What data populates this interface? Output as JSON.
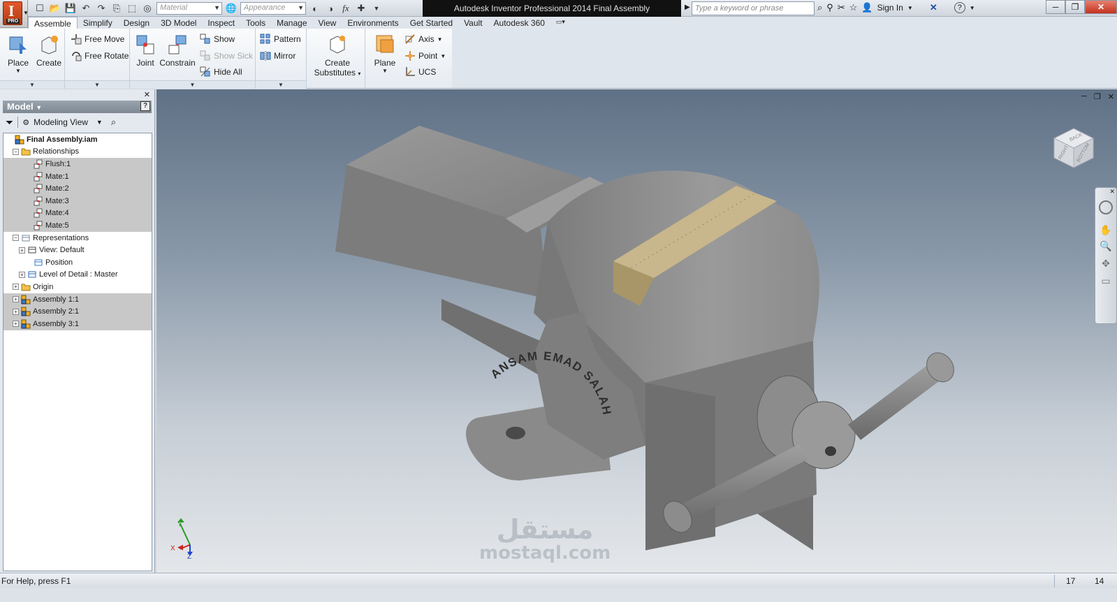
{
  "window": {
    "title": "Autodesk Inventor Professional 2014    Final Assembly",
    "app_badge": "PRO",
    "search_placeholder": "Type a keyword or phrase",
    "sign_in": "Sign In"
  },
  "qat": {
    "material_placeholder": "Material",
    "appearance_placeholder": "Appearance",
    "fx_label": "fx"
  },
  "tabs": [
    "Assemble",
    "Simplify",
    "Design",
    "3D Model",
    "Inspect",
    "Tools",
    "Manage",
    "View",
    "Environments",
    "Get Started",
    "Vault",
    "Autodesk 360"
  ],
  "ribbon": {
    "place": "Place",
    "create": "Create",
    "free_move": "Free Move",
    "free_rotate": "Free Rotate",
    "joint": "Joint",
    "constrain": "Constrain",
    "show": "Show",
    "show_sick": "Show Sick",
    "hide_all": "Hide All",
    "pattern": "Pattern",
    "mirror": "Mirror",
    "create_substitutes_1": "Create",
    "create_substitutes_2": "Substitutes",
    "plane": "Plane",
    "axis": "Axis",
    "point": "Point",
    "ucs": "UCS"
  },
  "browser": {
    "title": "Model",
    "view_label": "Modeling View",
    "tree": [
      {
        "label": "Final Assembly.iam",
        "indent": 0,
        "exp": "",
        "sel": false,
        "bold": true,
        "icon": "assembly-icon"
      },
      {
        "label": "Relationships",
        "indent": 1,
        "exp": "−",
        "sel": false,
        "bold": false,
        "icon": "folder-open-icon"
      },
      {
        "label": "Flush:1",
        "indent": 3,
        "exp": "",
        "sel": true,
        "bold": false,
        "icon": "flush-constraint-icon"
      },
      {
        "label": "Mate:1",
        "indent": 3,
        "exp": "",
        "sel": true,
        "bold": false,
        "icon": "mate-constraint-icon"
      },
      {
        "label": "Mate:2",
        "indent": 3,
        "exp": "",
        "sel": true,
        "bold": false,
        "icon": "mate-constraint-icon"
      },
      {
        "label": "Mate:3",
        "indent": 3,
        "exp": "",
        "sel": true,
        "bold": false,
        "icon": "insert-constraint-icon"
      },
      {
        "label": "Mate:4",
        "indent": 3,
        "exp": "",
        "sel": true,
        "bold": false,
        "icon": "mate-constraint-icon"
      },
      {
        "label": "Mate:5",
        "indent": 3,
        "exp": "",
        "sel": true,
        "bold": false,
        "icon": "mate-constraint-icon"
      },
      {
        "label": "Representations",
        "indent": 1,
        "exp": "−",
        "sel": false,
        "bold": false,
        "icon": "representations-icon"
      },
      {
        "label": "View: Default",
        "indent": 2,
        "exp": "+",
        "sel": false,
        "bold": false,
        "icon": "view-rep-icon"
      },
      {
        "label": "Position",
        "indent": 3,
        "exp": "",
        "sel": false,
        "bold": false,
        "icon": "position-rep-icon"
      },
      {
        "label": "Level of Detail : Master",
        "indent": 2,
        "exp": "+",
        "sel": false,
        "bold": false,
        "icon": "lod-icon"
      },
      {
        "label": "Origin",
        "indent": 1,
        "exp": "+",
        "sel": false,
        "bold": false,
        "icon": "folder-icon"
      },
      {
        "label": "Assembly 1:1",
        "indent": 1,
        "exp": "+",
        "sel": true,
        "bold": false,
        "icon": "subassembly-icon"
      },
      {
        "label": "Assembly 2:1",
        "indent": 1,
        "exp": "+",
        "sel": true,
        "bold": false,
        "icon": "subassembly-icon"
      },
      {
        "label": "Assembly 3:1",
        "indent": 1,
        "exp": "+",
        "sel": true,
        "bold": false,
        "icon": "subassembly-icon"
      }
    ]
  },
  "viewport": {
    "engraving": "ANSAM EMAD SALAH",
    "viewcube_top": "BACK",
    "viewcube_left": "RIGHT",
    "viewcube_right": "BOTTOM",
    "triad_x": "X",
    "triad_y": "Y",
    "triad_z": "Z",
    "watermark_ar": "مستقل",
    "watermark_en": "mostaql.com"
  },
  "status": {
    "help": "For Help, press F1",
    "count1": "17",
    "count2": "14"
  },
  "colors": {
    "accent": "#3a78c8",
    "vise_body": "#858585",
    "jaw_pad": "#c8b68c"
  }
}
